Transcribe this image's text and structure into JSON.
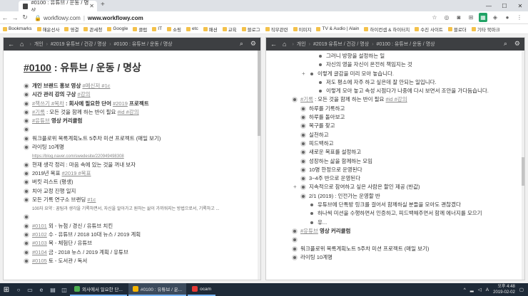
{
  "browser": {
    "tab_title": "#0100 : 유튜브 / 운동 / 명상",
    "url_host": "workflowy.com",
    "url_domain": "www.workflowy.com",
    "url_separator": "|"
  },
  "bookmarks": [
    "Bookmarks",
    "해운선사",
    "영결",
    "관세청",
    "Google",
    "클럽",
    "IT",
    "쇼핑",
    "etc",
    "패션",
    "교육",
    "블로그",
    "직무관련",
    "이미지",
    "TV & Audio | Alain",
    "하이컨셉 & 하이터치",
    "수진 사이트",
    "블로더",
    "기타 북마크"
  ],
  "left_panel": {
    "breadcrumbs": [
      "개인",
      "#2019 유튜브 / 건강 / 명상",
      "#0100 : 유튜브 / 운동 / 명상"
    ],
    "title_code": "#0100",
    "title_rest": " : 유튜브 / 운동 / 명상",
    "items": [
      {
        "pre": "",
        "bold": "개인 브랜드 홍보 영상 ",
        "tags": "#메신저 #1c",
        "post": ""
      },
      {
        "pre": "",
        "bold": "시간 관리 강의 구상 ",
        "tags": "#강의",
        "post": ""
      },
      {
        "pre": "",
        "bold": "",
        "tags": "#책쓰기 #목차",
        "post": " : 회사에 필요한 단어 ",
        "tags2": "#2019",
        "post2": " 프로젝트",
        "postbold": true
      },
      {
        "pre": "",
        "bold": "",
        "tags": "#기록",
        "post": " : 모든 것을 함께 하는 반이 필요 ",
        "tags2": "#id #강의",
        "post2": ""
      },
      {
        "pre": "",
        "bold": "",
        "tags": "#유튜브",
        "post": " 영상 커리큘럼",
        "postbold": true
      },
      {
        "pre": "",
        "bold": "",
        "tags": "",
        "post": ""
      },
      {
        "pre": "워크플로위 목록계획노트 5주차 미션 프로젝트 (매일 보기)",
        "bold": "",
        "tags": "",
        "post": ""
      },
      {
        "pre": "라이팅 10계명",
        "bold": "",
        "tags": "",
        "post": ""
      },
      {
        "link": "https://blog.naver.com/swedesite/220949498308"
      },
      {
        "pre": "현재 생각 정리 : 마음 속에 있는 것을 꺼내 보자",
        "bold": "",
        "tags": "",
        "post": ""
      },
      {
        "pre": "2019년 목표 ",
        "bold": "",
        "tags": "#2019 #목표",
        "post": ""
      },
      {
        "pre": "버킷 리스트 (평생)",
        "bold": "",
        "tags": "",
        "post": ""
      },
      {
        "pre": "치아 교정 진행 일지",
        "bold": "",
        "tags": "",
        "post": ""
      },
      {
        "pre": "모든 기록 연구소 브랜딩 ",
        "bold": "",
        "tags": "#1c",
        "post": ""
      },
      {
        "note": "100자 요약 : 꿈팀과 생각을 기록하면서, 자신을 알아가고 원하는 삶이 가까워지는 방법으로서, 기록하고 ..."
      },
      {
        "pre": "",
        "bold": "",
        "tags": "",
        "post": ""
      },
      {
        "pre": "",
        "bold": "",
        "tags": "#0101",
        "post": " 외 - 뉴첨 / 경신 / 유튜브 치킨"
      },
      {
        "pre": "",
        "bold": "",
        "tags": "#0102",
        "post": " 수 - 유튜브 / 2018 10대 뉴스 / 2019 계획"
      },
      {
        "pre": "",
        "bold": "",
        "tags": "#0103",
        "post": " 목 - 체험단 / 유튜브"
      },
      {
        "pre": "",
        "bold": "",
        "tags": "#0104",
        "post": " 금 - 2018 뉴스 / 2019 계획 / 유튜브"
      },
      {
        "pre": "",
        "bold": "",
        "tags": "#0105",
        "post": " 토 - 도서관 / 독서"
      }
    ]
  },
  "right_panel": {
    "breadcrumbs": [
      "개인",
      "#2019 유튜브 / 건강 / 명상",
      "#0100 : 유튜브 / 운동 / 명상"
    ],
    "items": [
      {
        "level": 3,
        "text": "그러니 방향을 설정하는 일"
      },
      {
        "level": 3,
        "text": "자신의 영을 자신이 온전히 책임지는 것"
      },
      {
        "level": 2,
        "text": "이렇게 글감을 미리 모아 놓습니다.",
        "plus": true
      },
      {
        "level": 3,
        "text": "저도 평소에 자주 하고 싶은데 잘 안되는 일입니다."
      },
      {
        "level": 3,
        "text": "이렇게 모아 놓고 속성 시점다가 나중에 다시 보면서 조안을 가다듬습니다."
      },
      {
        "level": 0,
        "tag": "#기록",
        "text": " : 모든 것을 함께 하는 반이 필요 ",
        "tag2": "#id #강의"
      },
      {
        "level": 1,
        "text": "하루를 기록하고"
      },
      {
        "level": 1,
        "text": "하루를 돌아보고"
      },
      {
        "level": 1,
        "text": "목구를 찾고"
      },
      {
        "level": 1,
        "text": "실천하고"
      },
      {
        "level": 1,
        "text": "피드백하고"
      },
      {
        "level": 1,
        "text": "새로운 목표를 설정하고"
      },
      {
        "level": 1,
        "text": "성장하는 삶을 함께하는 모임"
      },
      {
        "level": 1,
        "text": "10명 한정으로 운영된다"
      },
      {
        "level": 1,
        "text": "3~4주 반으로 운영된다"
      },
      {
        "level": 1,
        "text": "지속적으로 참여하고 싶은 사람은 할인 제공 (반값)",
        "plus": true
      },
      {
        "level": 1,
        "text": "2/1 (2019) : 인전가는 운영할 반"
      },
      {
        "level": 2,
        "text": "유튜브에 단톡방 링크를 걸어서 함께하실 분들을 모아도 괜찮겠다"
      },
      {
        "level": 2,
        "text": "하나씩 미션을 수행하면서 인증하고, 피드백해주면서 함께 에너지를 모으기"
      },
      {
        "level": 2,
        "text": "유..."
      },
      {
        "level": 0,
        "tag": "#유튜브",
        "text": " 영상 커리큘럼",
        "bold": true
      },
      {
        "level": 0,
        "text": ""
      },
      {
        "level": 0,
        "text": "워크플로위 목록계획노트 5주차 미션 프로젝트 (매일 보기)"
      },
      {
        "level": 0,
        "text": "라이팅 10계명"
      }
    ]
  },
  "taskbar": {
    "apps": [
      "외사에서 일요한 단...",
      "#0100 : 유튜브 / 운...",
      "ocam"
    ],
    "time": "오후 4:48",
    "date": "2019-02-02"
  }
}
